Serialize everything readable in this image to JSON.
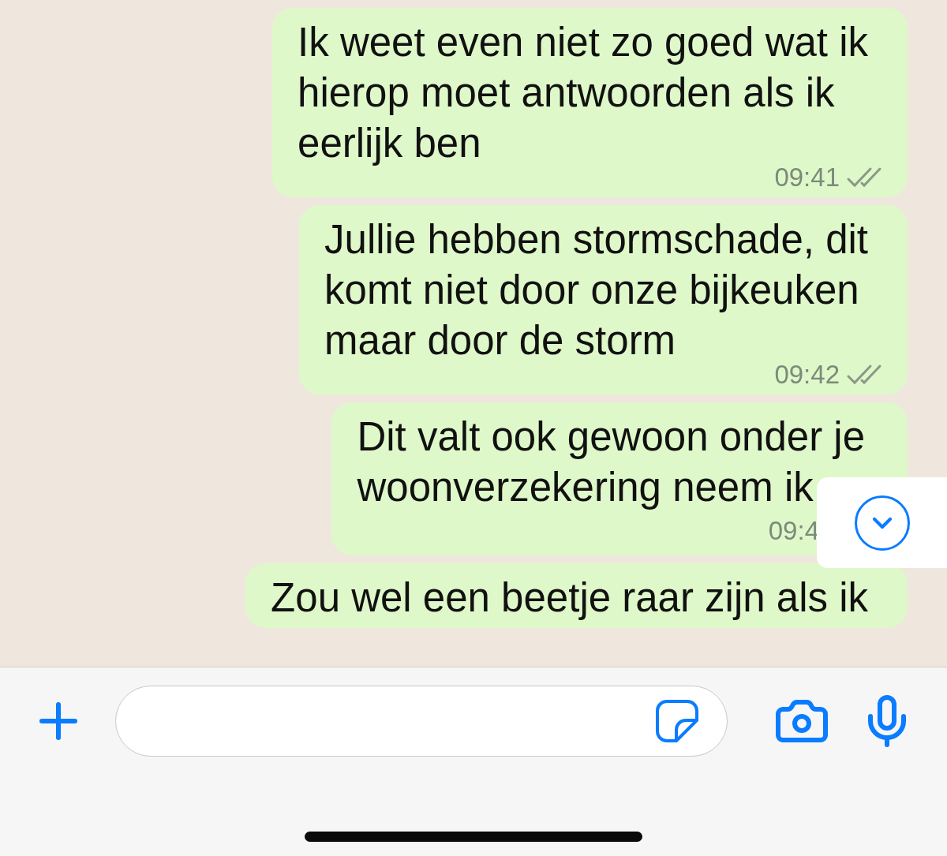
{
  "messages": [
    {
      "kind": "time-inline",
      "text": "Ik weet even niet zo goed wat ik\nhierop moet antwoorden als ik\neerlijk ben",
      "time": "09:41",
      "read": false
    },
    {
      "kind": "time-inline",
      "text": "Jullie hebben stormschade, dit\nkomt niet door onze bijkeuken\nmaar door de storm",
      "time": "09:42",
      "read": false
    },
    {
      "kind": "time-below",
      "text": "Dit valt ook gewoon onder je\nwoonverzekering neem ik",
      "time": "09:4"
    },
    {
      "kind": "time-inline",
      "text": "Zou wel een beetje raar zijn als ik"
    }
  ]
}
